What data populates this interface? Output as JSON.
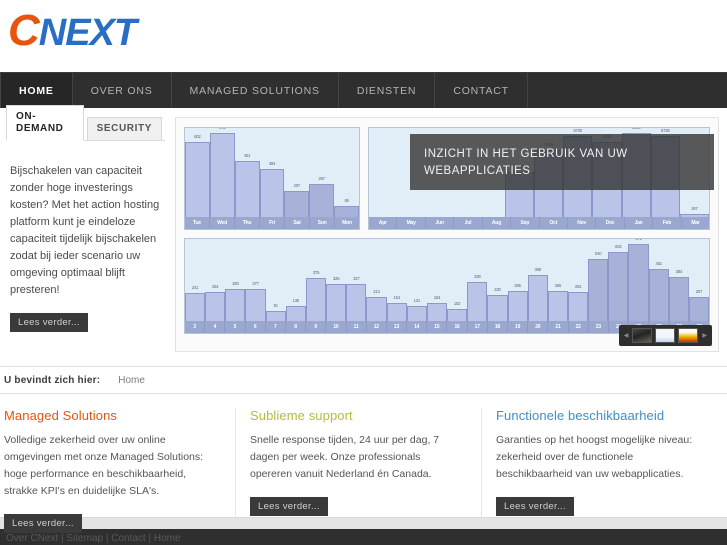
{
  "site": {
    "logo_c": "C",
    "logo_next": "NEXT",
    "brand_orange": "#e8540c",
    "brand_blue": "#2a6ec4"
  },
  "nav": {
    "items": [
      {
        "label": "HOME",
        "active": true
      },
      {
        "label": "OVER ONS",
        "active": false
      },
      {
        "label": "MANAGED SOLUTIONS",
        "active": false
      },
      {
        "label": "DIENSTEN",
        "active": false
      },
      {
        "label": "CONTACT",
        "active": false
      }
    ]
  },
  "sidebar": {
    "tabs": [
      {
        "label": "ON-DEMAND",
        "active": true
      },
      {
        "label": "SECURITY",
        "active": false
      }
    ],
    "body": "Bijschakelen van capaciteit zonder hoge investerings kosten? Met het action hosting platform kunt je eindeloze capaciteit tijdelijk bijschakelen zodat bij ieder scenario uw omgeving optimaal blijft presteren!",
    "more_label": "Lees verder..."
  },
  "showcase": {
    "caption": "INZICHT IN HET GEBRUIK VAN UW WEBAPPLICATIES",
    "pager": {
      "prev": "◀",
      "next": "▶",
      "thumbs": [
        "thumb-screenshot",
        "thumb-chart",
        "thumb-heatmap"
      ]
    }
  },
  "breadcrumb": {
    "label": "U bevindt zich hier:",
    "current": "Home"
  },
  "columns": [
    {
      "title": "Managed Solutions",
      "color": "#e8540c",
      "body": "Volledige zekerheid over uw online omgevingen met onze Managed Solutions: hoge performance en beschikbaarheid, strakke KPI's en duidelijke SLA's.",
      "more_label": "Lees verder..."
    },
    {
      "title": "Sublieme support",
      "color": "#b5bd34",
      "body": "Snelle response tijden, 24 uur per dag, 7 dagen per week. Onze professionals opereren vanuit Nederland én Canada.",
      "more_label": "Lees verder..."
    },
    {
      "title": "Functionele beschikbaarheid",
      "color": "#3d8ec9",
      "body": "Garanties op het hoogst mogelijke niveau: zekerheid over de functionele beschikbaarheid van uw webapplicaties.",
      "more_label": "Lees verder..."
    }
  ],
  "footer": {
    "links": "Over CNext  |  Sitemap  |  Contact  |  Home"
  },
  "chart_data": [
    {
      "id": "weekly",
      "type": "bar",
      "title": "",
      "categories": [
        "Tue",
        "Wed",
        "Thu",
        "Fri",
        "Sat",
        "Sun",
        "Mon"
      ],
      "values": [
        602,
        672,
        451,
        384,
        207,
        267,
        85
      ],
      "ylim": [
        0,
        700
      ],
      "xlabel": "",
      "ylabel": "",
      "grid": false,
      "legend": "none"
    },
    {
      "id": "monthly",
      "type": "bar",
      "title": "",
      "categories": [
        "Apr",
        "May",
        "Jun",
        "Jul",
        "Aug",
        "Sep",
        "Oct",
        "Nov",
        "Dec",
        "Jan",
        "Feb",
        "Mar"
      ],
      "values": [
        0,
        0,
        0,
        0,
        0,
        3736,
        5556,
        6730,
        6196,
        6956,
        6738,
        267
      ],
      "ylim": [
        0,
        7200
      ],
      "xlabel": "",
      "ylabel": "",
      "grid": false,
      "legend": "none"
    },
    {
      "id": "daily",
      "type": "bar",
      "title": "",
      "categories": [
        "3",
        "4",
        "5",
        "6",
        "7",
        "8",
        "9",
        "10",
        "11",
        "12",
        "13",
        "14",
        "15",
        "16",
        "17",
        "18",
        "19",
        "20",
        "21",
        "22",
        "23",
        "24",
        "25",
        "26",
        "27",
        "28"
      ],
      "values": [
        241,
        254,
        280,
        277,
        91,
        135,
        375,
        325,
        327,
        213,
        154,
        131,
        154,
        102,
        339,
        230,
        265,
        399,
        265,
        252,
        540,
        602,
        672,
        451,
        384,
        207
      ],
      "ylim": [
        0,
        700
      ],
      "xlabel": "",
      "ylabel": "",
      "grid": false,
      "legend": "none"
    }
  ]
}
